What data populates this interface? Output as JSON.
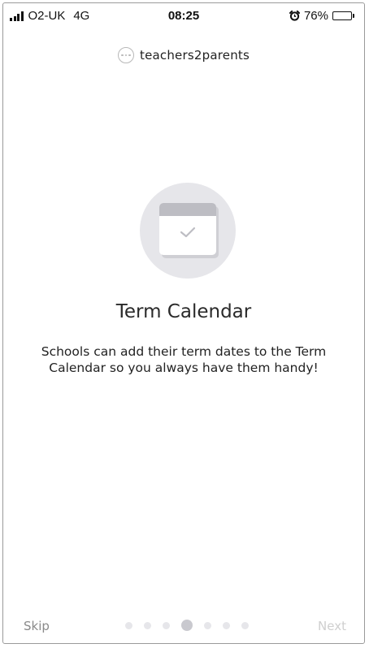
{
  "status_bar": {
    "carrier": "O2-UK",
    "network": "4G",
    "time": "08:25",
    "battery_percent": "76%",
    "battery_level": 0.76,
    "icons": [
      "signal-icon",
      "alarm-icon",
      "battery-icon"
    ]
  },
  "brand": {
    "name": "teachers2parents",
    "logo_icon": "ellipsis-circle-icon"
  },
  "feature": {
    "icon": "calendar-check-icon",
    "title": "Term Calendar",
    "description": "Schools can add their term dates to the Term Calendar so you always have them handy!"
  },
  "navigation": {
    "skip_label": "Skip",
    "next_label": "Next",
    "page_count": 7,
    "current_page": 4
  },
  "colors": {
    "illustration_bg": "#e6e6ea",
    "calendar_header": "#bdbdc3",
    "dot_inactive": "#e6e6ea",
    "dot_active": "#c9c9cf",
    "skip_text": "#8a8a8a",
    "next_text": "#cfcfcf"
  }
}
